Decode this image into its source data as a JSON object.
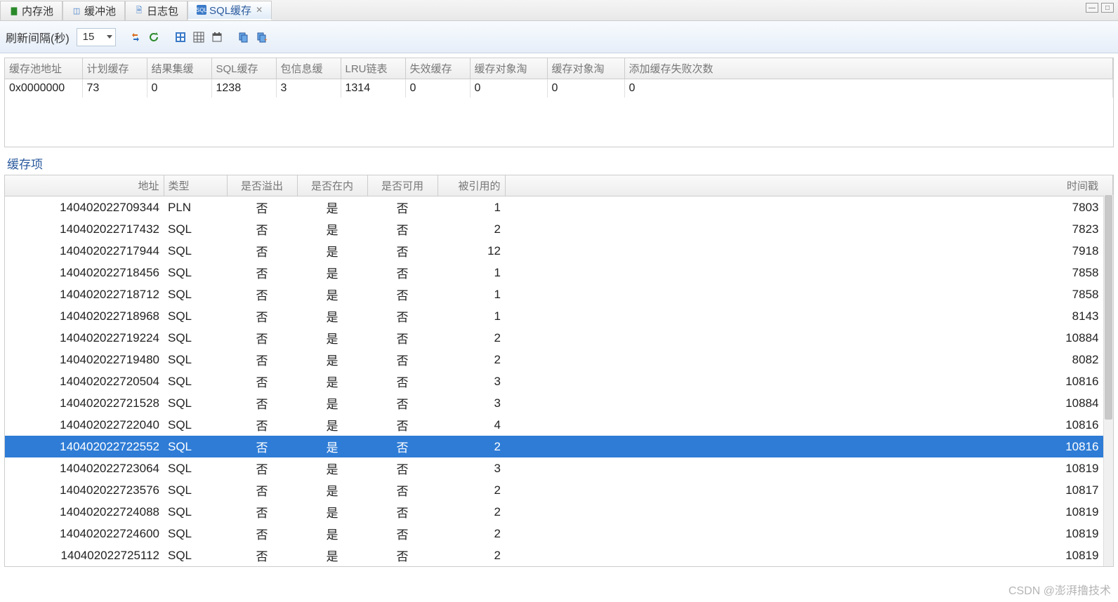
{
  "tabs": [
    {
      "label": "内存池",
      "icon_color": "#2a8a2a"
    },
    {
      "label": "缓冲池",
      "icon_color": "#3a7ac8"
    },
    {
      "label": "日志包",
      "icon_color": "#3a7ac8"
    },
    {
      "label": "SQL缓存",
      "icon_color": "#3a7ac8",
      "active": true
    }
  ],
  "toolbar": {
    "refresh_label": "刷新间隔(秒)",
    "refresh_value": "15"
  },
  "summary": {
    "headers": [
      "缓存池地址",
      "计划缓存",
      "结果集缓",
      "SQL缓存",
      "包信息缓",
      "LRU链表",
      "失效缓存",
      "缓存对象淘",
      "缓存对象淘",
      "添加缓存失败次数"
    ],
    "row": [
      "0x0000000",
      "73",
      "0",
      "1238",
      "3",
      "1314",
      "0",
      "0",
      "0",
      "0"
    ]
  },
  "section_label": "缓存项",
  "cache": {
    "headers": [
      "地址",
      "类型",
      "是否溢出",
      "是否在内",
      "是否可用",
      "被引用的",
      "时间戳"
    ],
    "rows": [
      {
        "addr": "140402022709344",
        "type": "PLN",
        "overflow": "否",
        "inmem": "是",
        "avail": "否",
        "ref": "1",
        "ts": "7803"
      },
      {
        "addr": "140402022717432",
        "type": "SQL",
        "overflow": "否",
        "inmem": "是",
        "avail": "否",
        "ref": "2",
        "ts": "7823"
      },
      {
        "addr": "140402022717944",
        "type": "SQL",
        "overflow": "否",
        "inmem": "是",
        "avail": "否",
        "ref": "12",
        "ts": "7918"
      },
      {
        "addr": "140402022718456",
        "type": "SQL",
        "overflow": "否",
        "inmem": "是",
        "avail": "否",
        "ref": "1",
        "ts": "7858"
      },
      {
        "addr": "140402022718712",
        "type": "SQL",
        "overflow": "否",
        "inmem": "是",
        "avail": "否",
        "ref": "1",
        "ts": "7858"
      },
      {
        "addr": "140402022718968",
        "type": "SQL",
        "overflow": "否",
        "inmem": "是",
        "avail": "否",
        "ref": "1",
        "ts": "8143"
      },
      {
        "addr": "140402022719224",
        "type": "SQL",
        "overflow": "否",
        "inmem": "是",
        "avail": "否",
        "ref": "2",
        "ts": "10884"
      },
      {
        "addr": "140402022719480",
        "type": "SQL",
        "overflow": "否",
        "inmem": "是",
        "avail": "否",
        "ref": "2",
        "ts": "8082"
      },
      {
        "addr": "140402022720504",
        "type": "SQL",
        "overflow": "否",
        "inmem": "是",
        "avail": "否",
        "ref": "3",
        "ts": "10816"
      },
      {
        "addr": "140402022721528",
        "type": "SQL",
        "overflow": "否",
        "inmem": "是",
        "avail": "否",
        "ref": "3",
        "ts": "10884"
      },
      {
        "addr": "140402022722040",
        "type": "SQL",
        "overflow": "否",
        "inmem": "是",
        "avail": "否",
        "ref": "4",
        "ts": "10816"
      },
      {
        "addr": "140402022722552",
        "type": "SQL",
        "overflow": "否",
        "inmem": "是",
        "avail": "否",
        "ref": "2",
        "ts": "10816",
        "selected": true
      },
      {
        "addr": "140402022723064",
        "type": "SQL",
        "overflow": "否",
        "inmem": "是",
        "avail": "否",
        "ref": "3",
        "ts": "10819"
      },
      {
        "addr": "140402022723576",
        "type": "SQL",
        "overflow": "否",
        "inmem": "是",
        "avail": "否",
        "ref": "2",
        "ts": "10817"
      },
      {
        "addr": "140402022724088",
        "type": "SQL",
        "overflow": "否",
        "inmem": "是",
        "avail": "否",
        "ref": "2",
        "ts": "10819"
      },
      {
        "addr": "140402022724600",
        "type": "SQL",
        "overflow": "否",
        "inmem": "是",
        "avail": "否",
        "ref": "2",
        "ts": "10819"
      },
      {
        "addr": "140402022725112",
        "type": "SQL",
        "overflow": "否",
        "inmem": "是",
        "avail": "否",
        "ref": "2",
        "ts": "10819"
      }
    ]
  },
  "watermark": "CSDN @澎湃撸技术"
}
